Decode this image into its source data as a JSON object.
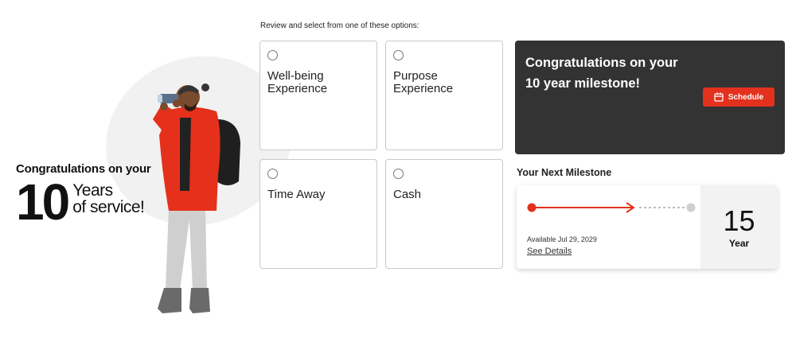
{
  "hero": {
    "congrats_line": "Congratulations on your",
    "years_number": "10",
    "years_text_1": "Years",
    "years_text_2": "of service!"
  },
  "options": {
    "prompt": "Review and select from one of these options:",
    "items": [
      {
        "label_1": "Well-being",
        "label_2": "Experience",
        "selected": false
      },
      {
        "label_1": "Purpose",
        "label_2": "Experience",
        "selected": false
      },
      {
        "label_1": "Time Away",
        "label_2": "",
        "selected": false
      },
      {
        "label_1": "Cash",
        "label_2": "",
        "selected": false
      }
    ]
  },
  "milestone_card": {
    "title_1": "Congratulations on your",
    "title_2": "10 year milestone!",
    "schedule_label": "Schedule",
    "schedule_icon": "calendar-icon"
  },
  "next_milestone": {
    "heading": "Your Next Milestone",
    "available": "Available Jul 29, 2029",
    "details_link": "See Details",
    "year_number": "15",
    "year_label": "Year"
  },
  "colors": {
    "accent_red": "#e3311d",
    "dark_card": "#333333",
    "border_gray": "#c9c9c9"
  }
}
